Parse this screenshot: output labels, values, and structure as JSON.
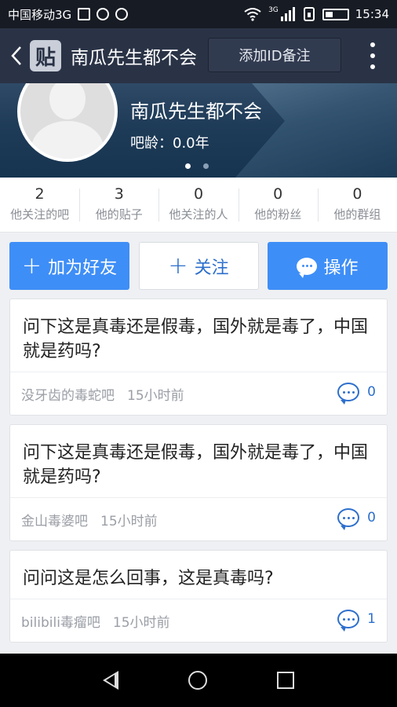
{
  "status_bar": {
    "carrier": "中国移动3G",
    "network_label": "3G",
    "time": "15:34",
    "battery_level": 0.25
  },
  "header": {
    "title": "南瓜先生都不会",
    "note_button": "添加ID备注",
    "logo_text": "贴"
  },
  "profile": {
    "name": "南瓜先生都不会",
    "age": "吧龄：0.0年",
    "carousel": {
      "count": 2,
      "active": 0
    }
  },
  "stats": [
    {
      "value": "2",
      "label": "他关注的吧"
    },
    {
      "value": "3",
      "label": "他的贴子"
    },
    {
      "value": "0",
      "label": "他关注的人"
    },
    {
      "value": "0",
      "label": "他的粉丝"
    },
    {
      "value": "0",
      "label": "他的群组"
    }
  ],
  "actions": {
    "add_friend": "加为好友",
    "follow": "关注",
    "operate": "操作",
    "plus_symbol": "+"
  },
  "posts": [
    {
      "title": "问下这是真毒还是假毒，国外就是毒了，中国就是药吗?",
      "forum": "没牙齿的毒蛇吧",
      "time": "15小时前",
      "comments": "0"
    },
    {
      "title": "问下这是真毒还是假毒，国外就是毒了，中国就是药吗?",
      "forum": "金山毒婆吧",
      "time": "15小时前",
      "comments": "0"
    },
    {
      "title": "问问这是怎么回事，这是真毒吗?",
      "forum": "bilibili毒瘤吧",
      "time": "15小时前",
      "comments": "1"
    }
  ],
  "colors": {
    "accent": "#3e8ef7",
    "header_bg": "#2a3346",
    "link": "#2d6fcc"
  },
  "icons": {
    "back": "chevron-left-icon",
    "more": "more-vertical-icon",
    "comment": "comment-bubble-icon"
  }
}
